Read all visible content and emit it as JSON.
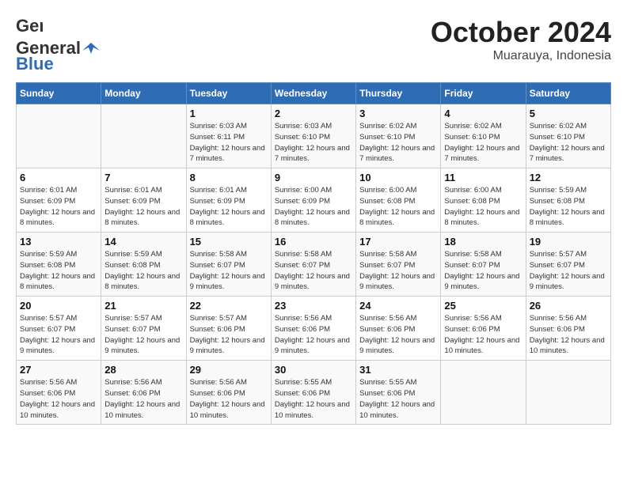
{
  "header": {
    "logo_line1": "General",
    "logo_line2": "Blue",
    "month": "October 2024",
    "location": "Muarauya, Indonesia"
  },
  "weekdays": [
    "Sunday",
    "Monday",
    "Tuesday",
    "Wednesday",
    "Thursday",
    "Friday",
    "Saturday"
  ],
  "weeks": [
    [
      {
        "day": null,
        "info": null
      },
      {
        "day": null,
        "info": null
      },
      {
        "day": "1",
        "info": "Sunrise: 6:03 AM\nSunset: 6:11 PM\nDaylight: 12 hours and 7 minutes."
      },
      {
        "day": "2",
        "info": "Sunrise: 6:03 AM\nSunset: 6:10 PM\nDaylight: 12 hours and 7 minutes."
      },
      {
        "day": "3",
        "info": "Sunrise: 6:02 AM\nSunset: 6:10 PM\nDaylight: 12 hours and 7 minutes."
      },
      {
        "day": "4",
        "info": "Sunrise: 6:02 AM\nSunset: 6:10 PM\nDaylight: 12 hours and 7 minutes."
      },
      {
        "day": "5",
        "info": "Sunrise: 6:02 AM\nSunset: 6:10 PM\nDaylight: 12 hours and 7 minutes."
      }
    ],
    [
      {
        "day": "6",
        "info": "Sunrise: 6:01 AM\nSunset: 6:09 PM\nDaylight: 12 hours and 8 minutes."
      },
      {
        "day": "7",
        "info": "Sunrise: 6:01 AM\nSunset: 6:09 PM\nDaylight: 12 hours and 8 minutes."
      },
      {
        "day": "8",
        "info": "Sunrise: 6:01 AM\nSunset: 6:09 PM\nDaylight: 12 hours and 8 minutes."
      },
      {
        "day": "9",
        "info": "Sunrise: 6:00 AM\nSunset: 6:09 PM\nDaylight: 12 hours and 8 minutes."
      },
      {
        "day": "10",
        "info": "Sunrise: 6:00 AM\nSunset: 6:08 PM\nDaylight: 12 hours and 8 minutes."
      },
      {
        "day": "11",
        "info": "Sunrise: 6:00 AM\nSunset: 6:08 PM\nDaylight: 12 hours and 8 minutes."
      },
      {
        "day": "12",
        "info": "Sunrise: 5:59 AM\nSunset: 6:08 PM\nDaylight: 12 hours and 8 minutes."
      }
    ],
    [
      {
        "day": "13",
        "info": "Sunrise: 5:59 AM\nSunset: 6:08 PM\nDaylight: 12 hours and 8 minutes."
      },
      {
        "day": "14",
        "info": "Sunrise: 5:59 AM\nSunset: 6:08 PM\nDaylight: 12 hours and 8 minutes."
      },
      {
        "day": "15",
        "info": "Sunrise: 5:58 AM\nSunset: 6:07 PM\nDaylight: 12 hours and 9 minutes."
      },
      {
        "day": "16",
        "info": "Sunrise: 5:58 AM\nSunset: 6:07 PM\nDaylight: 12 hours and 9 minutes."
      },
      {
        "day": "17",
        "info": "Sunrise: 5:58 AM\nSunset: 6:07 PM\nDaylight: 12 hours and 9 minutes."
      },
      {
        "day": "18",
        "info": "Sunrise: 5:58 AM\nSunset: 6:07 PM\nDaylight: 12 hours and 9 minutes."
      },
      {
        "day": "19",
        "info": "Sunrise: 5:57 AM\nSunset: 6:07 PM\nDaylight: 12 hours and 9 minutes."
      }
    ],
    [
      {
        "day": "20",
        "info": "Sunrise: 5:57 AM\nSunset: 6:07 PM\nDaylight: 12 hours and 9 minutes."
      },
      {
        "day": "21",
        "info": "Sunrise: 5:57 AM\nSunset: 6:07 PM\nDaylight: 12 hours and 9 minutes."
      },
      {
        "day": "22",
        "info": "Sunrise: 5:57 AM\nSunset: 6:06 PM\nDaylight: 12 hours and 9 minutes."
      },
      {
        "day": "23",
        "info": "Sunrise: 5:56 AM\nSunset: 6:06 PM\nDaylight: 12 hours and 9 minutes."
      },
      {
        "day": "24",
        "info": "Sunrise: 5:56 AM\nSunset: 6:06 PM\nDaylight: 12 hours and 9 minutes."
      },
      {
        "day": "25",
        "info": "Sunrise: 5:56 AM\nSunset: 6:06 PM\nDaylight: 12 hours and 10 minutes."
      },
      {
        "day": "26",
        "info": "Sunrise: 5:56 AM\nSunset: 6:06 PM\nDaylight: 12 hours and 10 minutes."
      }
    ],
    [
      {
        "day": "27",
        "info": "Sunrise: 5:56 AM\nSunset: 6:06 PM\nDaylight: 12 hours and 10 minutes."
      },
      {
        "day": "28",
        "info": "Sunrise: 5:56 AM\nSunset: 6:06 PM\nDaylight: 12 hours and 10 minutes."
      },
      {
        "day": "29",
        "info": "Sunrise: 5:56 AM\nSunset: 6:06 PM\nDaylight: 12 hours and 10 minutes."
      },
      {
        "day": "30",
        "info": "Sunrise: 5:55 AM\nSunset: 6:06 PM\nDaylight: 12 hours and 10 minutes."
      },
      {
        "day": "31",
        "info": "Sunrise: 5:55 AM\nSunset: 6:06 PM\nDaylight: 12 hours and 10 minutes."
      },
      {
        "day": null,
        "info": null
      },
      {
        "day": null,
        "info": null
      }
    ]
  ]
}
